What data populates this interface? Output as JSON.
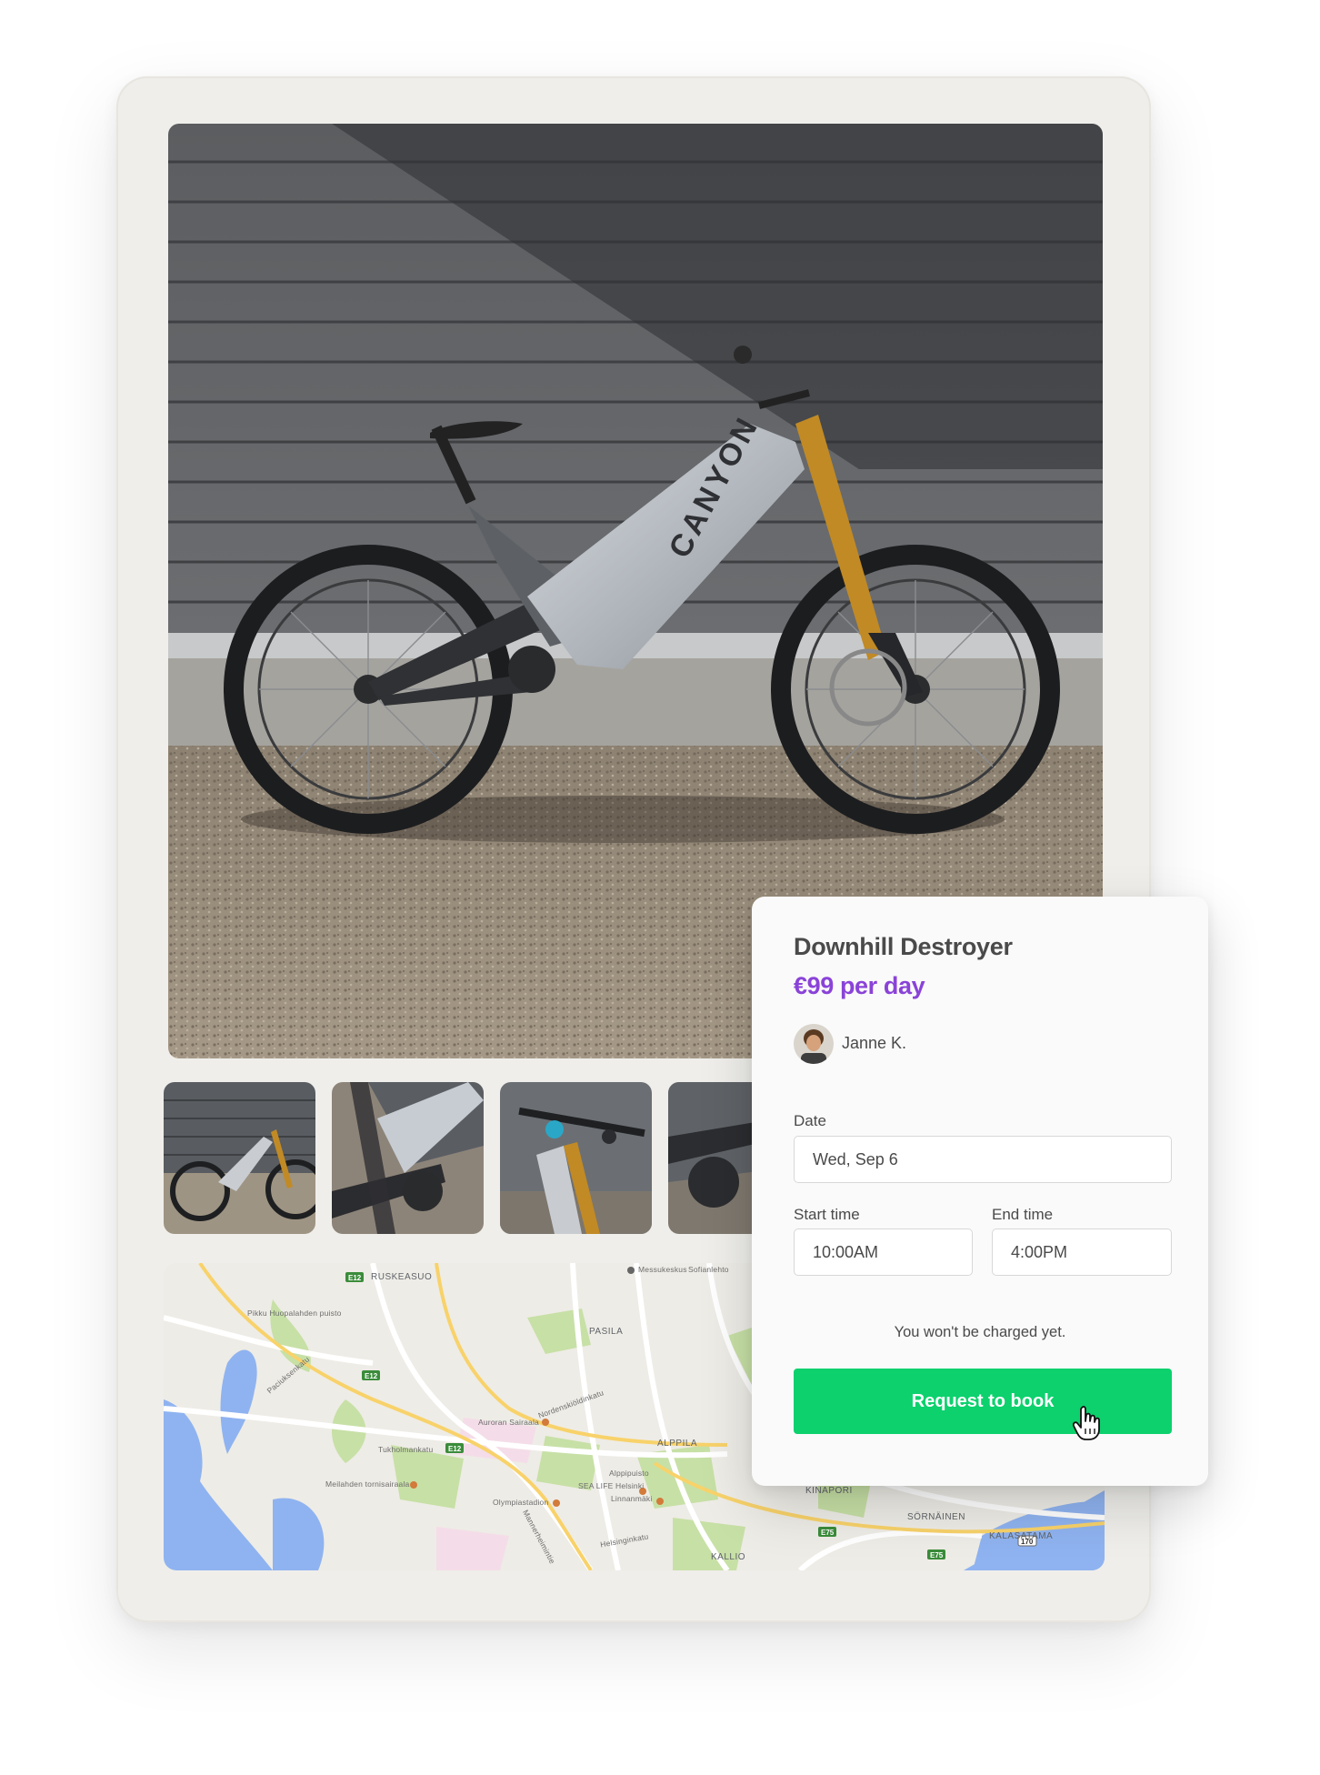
{
  "listing": {
    "title": "Downhill Destroyer",
    "price": "€99 per day",
    "host_name": "Janne K."
  },
  "booking": {
    "date_label": "Date",
    "date_value": "Wed, Sep 6",
    "start_label": "Start time",
    "start_value": "10:00AM",
    "end_label": "End time",
    "end_value": "4:00PM",
    "note": "You won't be charged yet.",
    "button_label": "Request to book"
  },
  "map": {
    "areas": [
      "RUSKEASUO",
      "PASILA",
      "ALPPILA",
      "KALLIO",
      "SÖRNÄINEN",
      "KALASATAMA",
      "KINAPORI"
    ],
    "pois": [
      "Messukeskus",
      "Sofianlehto",
      "Auroran Sairaala",
      "Meilahden tornisairaala",
      "SEA LIFE Helsinki",
      "Linnanmäki",
      "Olympiastadion",
      "Alppipuisto"
    ],
    "streets": [
      "Tukholmankatu",
      "Paciuksenkatu",
      "Mannerheimintie",
      "Nordenskiöldinkatu",
      "Helsinginkatu",
      "Pikku Huopalahden puisto"
    ],
    "road_shields": [
      "E12",
      "E12",
      "E12",
      "E75",
      "E75",
      "170"
    ]
  },
  "colors": {
    "accent_price": "#8a43d8",
    "button": "#0cd16d",
    "device_bg": "#efeeea"
  },
  "icons": [
    "hand-pointer-cursor-icon"
  ]
}
